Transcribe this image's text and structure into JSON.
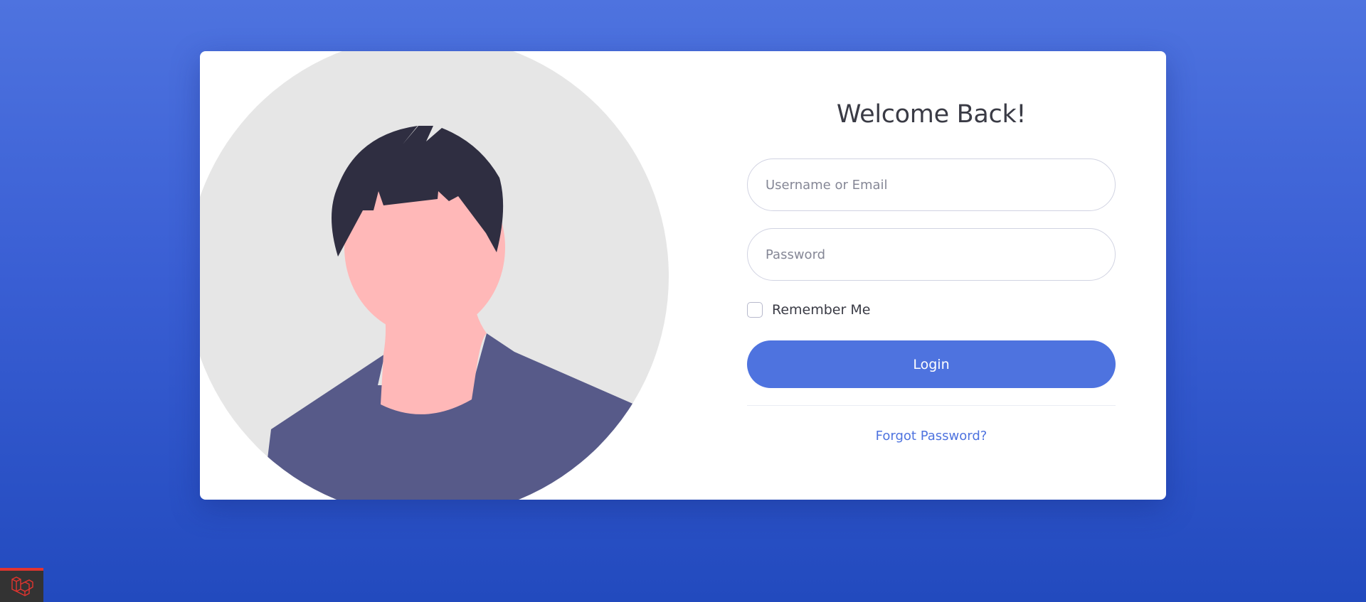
{
  "login": {
    "title": "Welcome Back!",
    "username_placeholder": "Username or Email",
    "password_placeholder": "Password",
    "remember_label": "Remember Me",
    "login_label": "Login",
    "forgot_label": "Forgot Password?"
  },
  "icons": {
    "illustration": "user-avatar-illustration",
    "badge": "laravel-logo-icon"
  },
  "colors": {
    "primary": "#4e73df",
    "background_gradient_top": "#4e73df",
    "background_gradient_bottom": "#224abe",
    "badge_accent": "#e3342f"
  }
}
